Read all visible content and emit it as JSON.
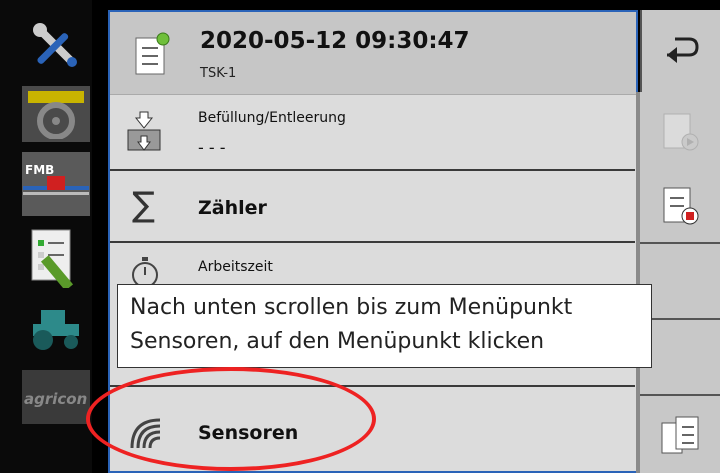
{
  "header": {
    "title": "2020-05-12 09:30:47",
    "subtitle": "TSK-1"
  },
  "menu": {
    "items": [
      {
        "label": "Befüllung/Entleerung",
        "value": "- - -"
      },
      {
        "label": "Zähler"
      },
      {
        "label": "Arbeitszeit"
      },
      {
        "label": "Sensoren"
      }
    ]
  },
  "left_sidebar": {
    "items": [
      "settings-icon",
      "tractor-icon",
      "sprayer-fmb-icon",
      "task-edit-icon",
      "tractor-green-icon",
      "agricon-logo"
    ],
    "fmb_text": "FMB",
    "agricon_text": "agricon"
  },
  "tooltip": {
    "line1": "Nach unten scrollen bis zum Menüpunkt",
    "line2": "Sensoren, auf den Menüpunkt klicken"
  },
  "colors": {
    "highlight": "#e22222",
    "border": "#2a63b8",
    "green_led": "#6fbf3a"
  }
}
